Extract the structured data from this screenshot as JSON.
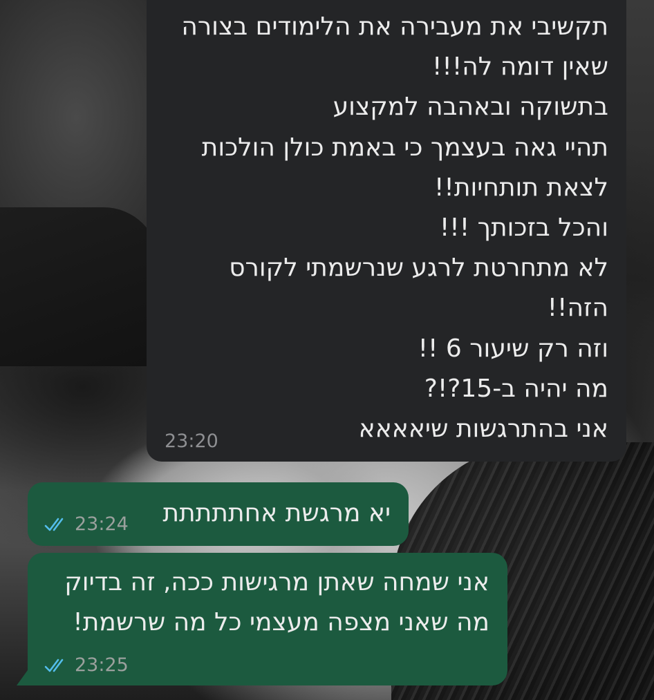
{
  "messages": [
    {
      "direction": "incoming",
      "lines": [
        "תקשיבי את מעבירה את הלימודים בצורה",
        "שאין דומה לה!!!",
        "בתשוקה ובאהבה למקצוע",
        "תהיי גאה בעצמך כי באמת כולן הולכות",
        "לצאת תותחיות!!",
        "והכל בזכותך !!!",
        "לא מתחרטת לרגע שנרשמתי לקורס",
        "הזה!!",
        "וזה רק שיעור 6 !!",
        "מה יהיה ב-15?!?",
        "אני בהתרגשות שיאאאא"
      ],
      "time": "23:20"
    },
    {
      "direction": "outgoing",
      "lines": [
        "יא מרגשת אחתתתתת"
      ],
      "time": "23:24",
      "status_icon": "double-check-read-icon"
    },
    {
      "direction": "outgoing",
      "lines": [
        "אני שמחה שאתן מרגישות ככה, זה בדיוק",
        "מה שאני מצפה מעצמי כל מה שרשמת!"
      ],
      "time": "23:25",
      "status_icon": "double-check-read-icon"
    }
  ],
  "colors": {
    "incoming_bubble": "#242527",
    "outgoing_bubble": "#1c5a3f",
    "text": "#ececec",
    "read_ticks": "#53bdeb"
  }
}
